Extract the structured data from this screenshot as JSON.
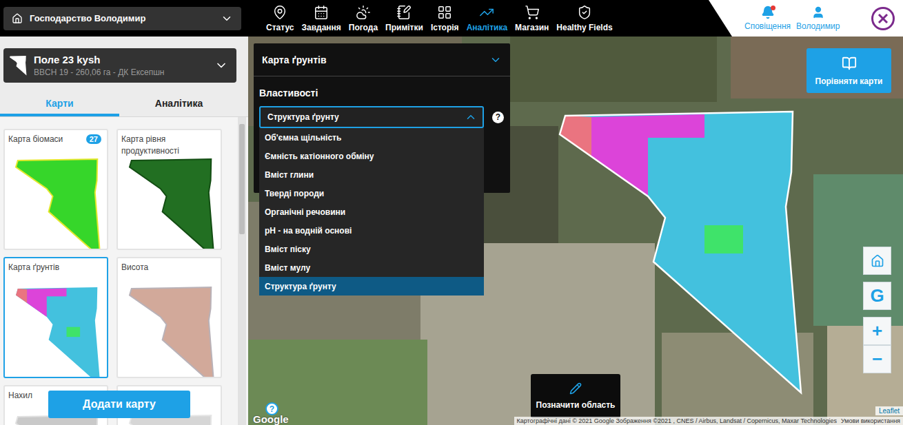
{
  "farm": {
    "name": "Господарство Володимир"
  },
  "nav": [
    {
      "label": "Статус",
      "selected": false
    },
    {
      "label": "Завдання",
      "selected": false
    },
    {
      "label": "Погода",
      "selected": false
    },
    {
      "label": "Примітки",
      "selected": false
    },
    {
      "label": "Історія",
      "selected": false
    },
    {
      "label": "Аналітика",
      "selected": true
    },
    {
      "label": "Магазин",
      "selected": false
    },
    {
      "label": "Healthy Fields",
      "selected": false
    }
  ],
  "user": {
    "notifications": "Сповіщення",
    "has_unread": true,
    "name": "Володимир"
  },
  "field": {
    "name": "Поле 23 kysh",
    "details": "BBCH 19 - 260,06 га - ДК Ексепшн"
  },
  "sidebar_tabs": [
    {
      "label": "Карти",
      "selected": true
    },
    {
      "label": "Аналітика",
      "selected": false
    }
  ],
  "map_cards": [
    {
      "title": "Карта біомаси",
      "badge": "27",
      "kind": "biomass",
      "selected": false
    },
    {
      "title": "Карта рівня продуктивності",
      "kind": "productivity",
      "selected": false
    },
    {
      "title": "Карта ґрунтів",
      "kind": "soil",
      "selected": true
    },
    {
      "title": "Висота",
      "kind": "elevation",
      "selected": false
    },
    {
      "title": "Нахил",
      "kind": "slope",
      "selected": false
    },
    {
      "kind": "blank",
      "selected": false
    }
  ],
  "add_button": "Додати карту",
  "panel": {
    "title": "Карта ґрунтів",
    "expanded": true,
    "property_label": "Властивості",
    "value": "Структура ґрунту",
    "open": true,
    "help": "?",
    "options": [
      {
        "label": "Об'ємна щільність",
        "selected": false
      },
      {
        "label": "Ємність катіонного обміну",
        "selected": false
      },
      {
        "label": "Вміст глини",
        "selected": false
      },
      {
        "label": "Тверді породи",
        "selected": false
      },
      {
        "label": "Органічні речовини",
        "selected": false
      },
      {
        "label": "pH - на водній основі",
        "selected": false
      },
      {
        "label": "Вміст піску",
        "selected": false
      },
      {
        "label": "Вміст мулу",
        "selected": false
      },
      {
        "label": "Структура ґрунту",
        "selected": true
      }
    ]
  },
  "soil_zones": [
    {
      "color": "#43c1de"
    },
    {
      "color": "#dc44d9"
    },
    {
      "color": "#ea7480"
    },
    {
      "color": "#3fe36a"
    }
  ],
  "compare_button": "Порівняти карти",
  "draw_button": "Позначити область",
  "map_controls": {
    "google": "G",
    "zoom_in": "+",
    "zoom_out": "−"
  },
  "attribution": {
    "logo": "Google",
    "help": "?",
    "text": "Картографічні дані © 2021 Google Зображення ©2021 , CNES / Airbus, Landsat / Copernicus, Maxar Technologies",
    "terms": "Умови використання",
    "leaflet": "Leaflet"
  }
}
